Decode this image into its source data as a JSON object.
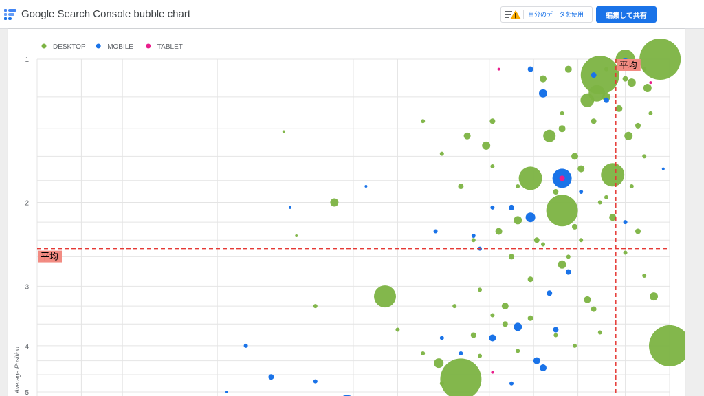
{
  "app": {
    "title": "Google Search Console bubble chart",
    "logo_icon": "looker-studio-logo-icon"
  },
  "header": {
    "data_credentials_label": "自分のデータを使用",
    "data_credentials_icon": "warning-icon",
    "share_label": "編集して共有"
  },
  "colors": {
    "desktop": "#7cb342",
    "mobile": "#1a73e8",
    "tablet": "#e91e8c",
    "average_line": "#e53935",
    "average_label_bg": "#f28b82",
    "share_button": "#1a73e8"
  },
  "chart_data": {
    "type": "scatter",
    "legend": [
      {
        "name": "DESKTOP",
        "color": "#7cb342"
      },
      {
        "name": "MOBILE",
        "color": "#1a73e8"
      },
      {
        "name": "TABLET",
        "color": "#e91e8c"
      }
    ],
    "legend_position": "top-left",
    "ylabel": "Average Position",
    "y_ticks": [
      "1",
      "2",
      "3",
      "4",
      "5"
    ],
    "y_reversed": true,
    "y_scale": "log",
    "ylim": [
      1,
      5.1
    ],
    "grid": true,
    "average_label": "平均",
    "average_y": 2.5,
    "average_x_fraction": 0.915,
    "x_label": "",
    "series": [
      {
        "name": "DESKTOP",
        "points": [
          [
            0.985,
            1.0,
            3.0
          ],
          [
            0.93,
            1.0,
            1.4
          ],
          [
            0.89,
            1.08,
            2.8
          ],
          [
            0.885,
            1.18,
            1.2
          ],
          [
            0.965,
            1.15,
            0.6
          ],
          [
            0.94,
            1.12,
            0.6
          ],
          [
            0.9,
            1.2,
            0.6
          ],
          [
            0.87,
            1.22,
            1.0
          ],
          [
            0.81,
            1.45,
            0.9
          ],
          [
            0.71,
            1.52,
            0.6
          ],
          [
            0.78,
            1.78,
            1.7
          ],
          [
            0.91,
            1.75,
            1.7
          ],
          [
            0.83,
            2.08,
            2.3
          ],
          [
            0.76,
            2.18,
            0.6
          ],
          [
            0.47,
            2.0,
            0.6
          ],
          [
            0.55,
            3.15,
            1.6
          ],
          [
            0.67,
            4.7,
            3.0
          ],
          [
            0.635,
            4.35,
            0.7
          ],
          [
            1.0,
            4.0,
            3.0
          ],
          [
            0.975,
            3.15,
            0.6
          ],
          [
            0.83,
            2.7,
            0.6
          ],
          [
            0.87,
            3.2,
            0.5
          ],
          [
            0.68,
            1.45,
            0.5
          ],
          [
            0.935,
            1.45,
            0.6
          ],
          [
            0.72,
            1.35,
            0.4
          ],
          [
            0.61,
            1.35,
            0.3
          ],
          [
            0.92,
            1.27,
            0.5
          ],
          [
            0.88,
            1.35,
            0.4
          ],
          [
            0.83,
            1.4,
            0.5
          ],
          [
            0.85,
            1.6,
            0.5
          ],
          [
            0.8,
            1.1,
            0.5
          ],
          [
            0.84,
            1.05,
            0.5
          ],
          [
            0.97,
            1.3,
            0.3
          ],
          [
            0.95,
            1.38,
            0.4
          ],
          [
            0.86,
            1.7,
            0.5
          ],
          [
            0.96,
            1.6,
            0.3
          ],
          [
            0.91,
            2.15,
            0.5
          ],
          [
            0.95,
            2.3,
            0.4
          ],
          [
            0.73,
            2.3,
            0.5
          ],
          [
            0.79,
            2.4,
            0.4
          ],
          [
            0.85,
            2.25,
            0.4
          ],
          [
            0.69,
            2.4,
            0.3
          ],
          [
            0.75,
            2.6,
            0.4
          ],
          [
            0.78,
            2.9,
            0.4
          ],
          [
            0.74,
            3.3,
            0.5
          ],
          [
            0.7,
            3.05,
            0.3
          ],
          [
            0.78,
            3.5,
            0.4
          ],
          [
            0.88,
            3.35,
            0.4
          ],
          [
            0.74,
            3.6,
            0.4
          ],
          [
            0.89,
            3.75,
            0.3
          ],
          [
            0.69,
            3.8,
            0.4
          ],
          [
            0.44,
            3.3,
            0.3
          ],
          [
            0.41,
            2.35,
            0.2
          ],
          [
            0.39,
            1.42,
            0.2
          ],
          [
            0.57,
            3.7,
            0.3
          ],
          [
            0.66,
            3.3,
            0.3
          ],
          [
            0.85,
            4.0,
            0.3
          ],
          [
            0.96,
            2.85,
            0.3
          ],
          [
            0.94,
            1.85,
            0.3
          ],
          [
            0.9,
            1.95,
            0.3
          ],
          [
            0.82,
            1.9,
            0.4
          ],
          [
            0.76,
            1.85,
            0.3
          ],
          [
            0.67,
            1.85,
            0.4
          ],
          [
            0.86,
            2.4,
            0.3
          ],
          [
            0.93,
            2.55,
            0.3
          ],
          [
            0.8,
            2.45,
            0.3
          ],
          [
            0.72,
            3.45,
            0.3
          ],
          [
            0.64,
            4.8,
            0.3
          ],
          [
            0.7,
            4.2,
            0.3
          ],
          [
            0.61,
            4.15,
            0.3
          ],
          [
            0.76,
            4.1,
            0.3
          ],
          [
            0.82,
            3.8,
            0.3
          ],
          [
            0.93,
            1.1,
            0.4
          ],
          [
            0.96,
            1.05,
            0.3
          ],
          [
            0.9,
            1.05,
            0.3
          ],
          [
            0.83,
            1.3,
            0.3
          ],
          [
            0.89,
            2.0,
            0.3
          ],
          [
            0.72,
            1.68,
            0.3
          ],
          [
            0.64,
            1.58,
            0.3
          ],
          [
            0.84,
            2.6,
            0.3
          ]
        ]
      },
      {
        "name": "MOBILE",
        "points": [
          [
            0.83,
            1.78,
            1.4
          ],
          [
            0.93,
            1.02,
            0.7
          ],
          [
            0.8,
            1.18,
            0.6
          ],
          [
            0.78,
            2.15,
            0.7
          ],
          [
            0.49,
            5.3,
            1.3
          ],
          [
            0.33,
            4.0,
            0.3
          ],
          [
            0.37,
            4.65,
            0.4
          ],
          [
            0.44,
            4.75,
            0.3
          ],
          [
            0.72,
            3.85,
            0.5
          ],
          [
            0.76,
            3.65,
            0.6
          ],
          [
            0.8,
            4.45,
            0.5
          ],
          [
            0.79,
            4.3,
            0.5
          ],
          [
            0.82,
            3.7,
            0.4
          ],
          [
            0.81,
            3.1,
            0.4
          ],
          [
            0.75,
            2.05,
            0.4
          ],
          [
            0.69,
            2.35,
            0.3
          ],
          [
            0.67,
            4.15,
            0.3
          ],
          [
            0.78,
            1.05,
            0.4
          ],
          [
            0.88,
            1.08,
            0.4
          ],
          [
            0.9,
            1.22,
            0.4
          ],
          [
            0.63,
            2.3,
            0.3
          ],
          [
            0.4,
            2.05,
            0.2
          ],
          [
            0.52,
            1.85,
            0.2
          ],
          [
            0.99,
            1.7,
            0.2
          ],
          [
            0.3,
            5.0,
            0.2
          ],
          [
            0.84,
            2.8,
            0.4
          ],
          [
            0.64,
            3.85,
            0.3
          ],
          [
            0.75,
            4.8,
            0.3
          ],
          [
            0.72,
            2.05,
            0.3
          ],
          [
            0.7,
            2.5,
            0.3
          ],
          [
            0.86,
            1.9,
            0.3
          ],
          [
            0.93,
            2.2,
            0.3
          ]
        ]
      },
      {
        "name": "TABLET",
        "points": [
          [
            0.83,
            1.78,
            0.4
          ],
          [
            0.73,
            1.05,
            0.2
          ],
          [
            0.72,
            4.55,
            0.2
          ],
          [
            0.97,
            1.12,
            0.2
          ]
        ]
      }
    ]
  }
}
